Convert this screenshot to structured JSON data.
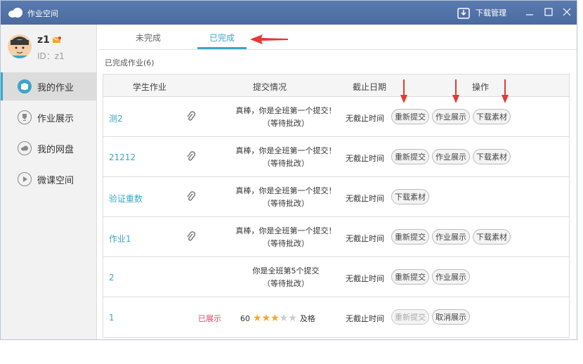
{
  "titlebar": {
    "title": "作业空间",
    "download_manager": "下载管理"
  },
  "user": {
    "name": "z1",
    "id_label": "ID：z1"
  },
  "sidebar": {
    "items": [
      {
        "label": "我的作业",
        "icon": "book-icon",
        "active": true
      },
      {
        "label": "作业展示",
        "icon": "trophy-icon",
        "active": false
      },
      {
        "label": "我的网盘",
        "icon": "cloud-icon",
        "active": false
      },
      {
        "label": "微课空间",
        "icon": "play-icon",
        "active": false
      }
    ]
  },
  "tabs": {
    "incomplete": "未完成",
    "complete": "已完成"
  },
  "count_label": "已完成作业(6)",
  "table": {
    "headers": {
      "student_work": "学生作业",
      "submission": "提交情况",
      "deadline": "截止日期",
      "actions": "操作"
    },
    "rows": [
      {
        "name": "测2",
        "line1": "真棒，你是全班第一个提交！",
        "line2": "（等待批改）",
        "deadline": "无截止时间",
        "btn1": "重新提交",
        "btn2": "作业展示",
        "btn3": "下载素材"
      },
      {
        "name": "21212",
        "line1": "真棒，你是全班第一个提交！",
        "line2": "（等待批改）",
        "deadline": "无截止时间",
        "btn1": "重新提交",
        "btn2": "作业展示",
        "btn3": "下载素材"
      },
      {
        "name": "验证重数",
        "line1": "真棒，你是全班第一个提交！",
        "line2": "（等待批改）",
        "deadline": "无截止时间",
        "btn1": "下载素材"
      },
      {
        "name": "作业1",
        "line1": "真棒，你是全班第一个提交！",
        "line2": "（等待批改）",
        "deadline": "无截止时间",
        "btn1": "重新提交",
        "btn2": "作业展示",
        "btn3": "下载素材"
      },
      {
        "name": "2",
        "line1": "你是全班第5个提交",
        "line2": "（等待批改）",
        "deadline": "无截止时间",
        "btn1": "重新提交",
        "btn2": "作业展示"
      },
      {
        "name": "1",
        "shown_label": "已展示",
        "score": "60",
        "grade": "及格",
        "stars": 3,
        "stars_total": 5,
        "deadline": "无截止时间",
        "btn1": "重新提交",
        "btn2": "取消展示"
      }
    ]
  },
  "colors": {
    "accent": "#3aa6c9",
    "titlebar": "#4a6aa0",
    "arrow": "#e53935",
    "shown": "#e0446c",
    "star": "#f5a623"
  }
}
